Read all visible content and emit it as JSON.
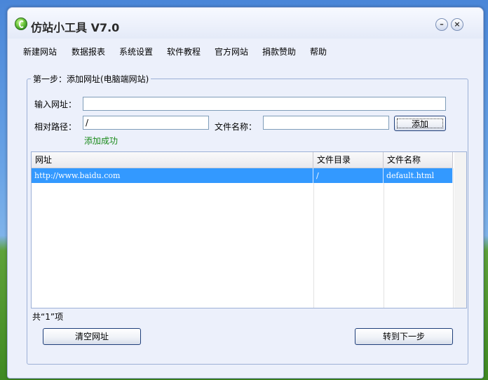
{
  "window": {
    "title": "仿站小工具 V7.0"
  },
  "menu": {
    "items": [
      "新建网站",
      "数据报表",
      "系统设置",
      "软件教程",
      "官方网站",
      "捐款赞助",
      "帮助"
    ]
  },
  "step": {
    "title": "第一步：添加网址(电脑端网站)",
    "url_label": "输入网址：",
    "url_value": "",
    "path_label": "相对路径：",
    "path_value": "/",
    "filename_label": "文件名称：",
    "filename_value": "",
    "add_button": "添加",
    "status": "添加成功"
  },
  "table": {
    "columns": [
      "网址",
      "文件目录",
      "文件名称"
    ],
    "rows": [
      {
        "url": "http://www.baidu.com",
        "dir": "/",
        "file": "default.html"
      }
    ]
  },
  "footer": {
    "count_text": "共“1”项",
    "clear_button": "清空网址",
    "next_button": "转到下一步"
  }
}
